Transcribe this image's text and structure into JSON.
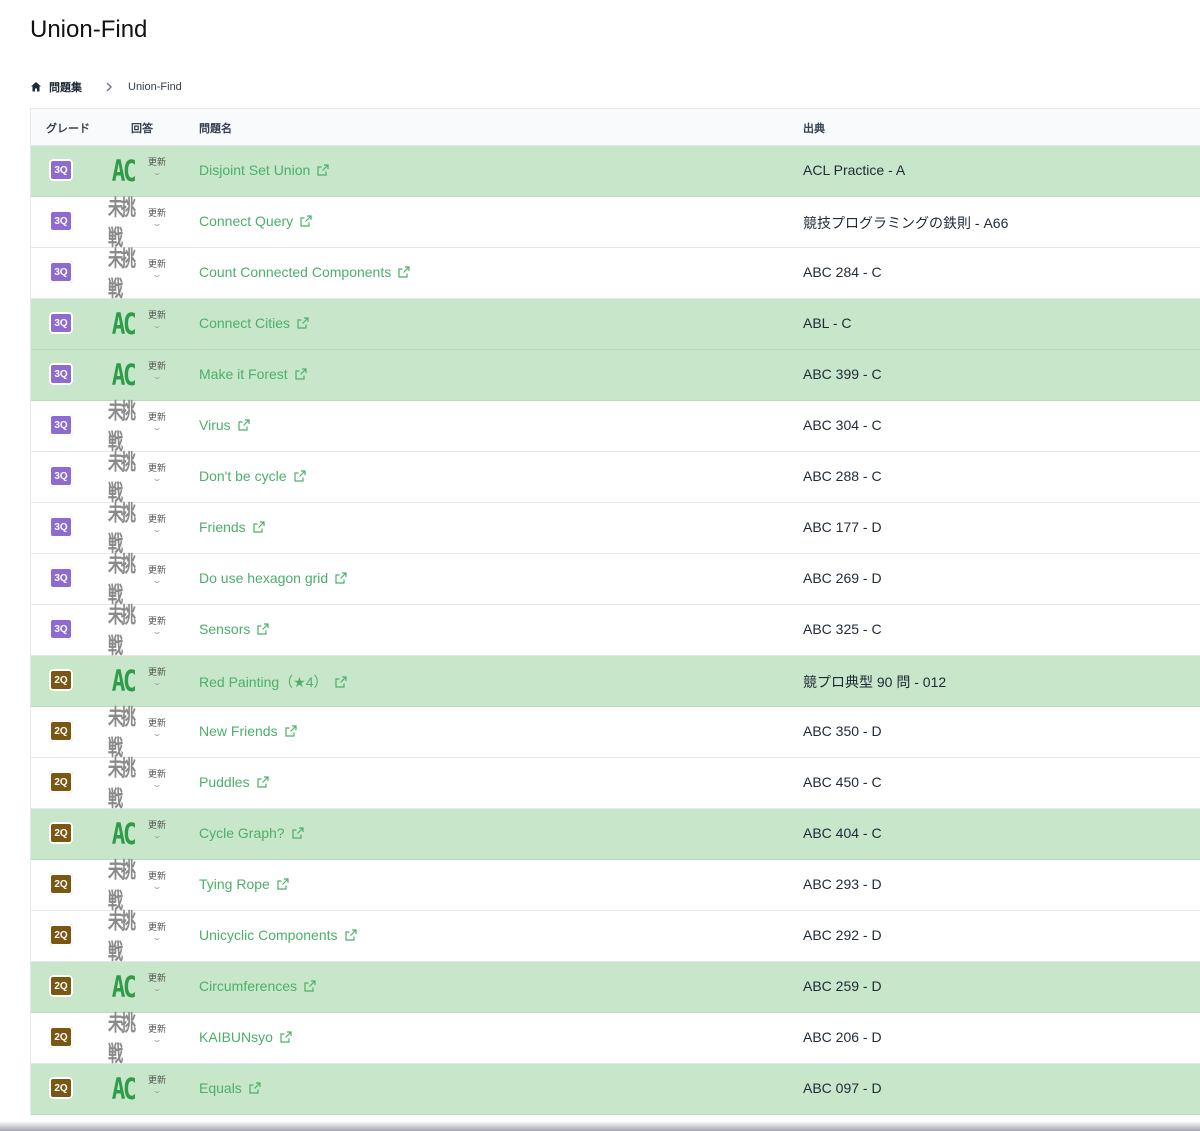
{
  "page_title": "Union-Find",
  "breadcrumb": {
    "home_label": "問題集",
    "current": "Union-Find"
  },
  "table": {
    "headers": {
      "grade": "グレード",
      "answer": "回答",
      "title": "問題名",
      "source": "出典"
    },
    "update_label": "更新",
    "rows": [
      {
        "grade": "3Q",
        "answer": "AC",
        "title": "Disjoint Set Union",
        "source": "ACL Practice - A"
      },
      {
        "grade": "3Q",
        "answer": "未挑戦",
        "title": "Connect Query",
        "source": "競技プログラミングの鉄則 - A66"
      },
      {
        "grade": "3Q",
        "answer": "未挑戦",
        "title": "Count Connected Components",
        "source": "ABC 284 - C"
      },
      {
        "grade": "3Q",
        "answer": "AC",
        "title": "Connect Cities",
        "source": "ABL - C"
      },
      {
        "grade": "3Q",
        "answer": "AC",
        "title": "Make it Forest",
        "source": "ABC 399 - C"
      },
      {
        "grade": "3Q",
        "answer": "未挑戦",
        "title": "Virus",
        "source": "ABC 304 - C"
      },
      {
        "grade": "3Q",
        "answer": "未挑戦",
        "title": "Don't be cycle",
        "source": "ABC 288 - C"
      },
      {
        "grade": "3Q",
        "answer": "未挑戦",
        "title": "Friends",
        "source": "ABC 177 - D"
      },
      {
        "grade": "3Q",
        "answer": "未挑戦",
        "title": "Do use hexagon grid",
        "source": "ABC 269 - D"
      },
      {
        "grade": "3Q",
        "answer": "未挑戦",
        "title": "Sensors",
        "source": "ABC 325 - C"
      },
      {
        "grade": "2Q",
        "answer": "AC",
        "title": "Red Painting（★4）",
        "source": "競プロ典型 90 問 - 012"
      },
      {
        "grade": "2Q",
        "answer": "未挑戦",
        "title": "New Friends",
        "source": "ABC 350 - D"
      },
      {
        "grade": "2Q",
        "answer": "未挑戦",
        "title": "Puddles",
        "source": "ABC 450 - C"
      },
      {
        "grade": "2Q",
        "answer": "AC",
        "title": "Cycle Graph?",
        "source": "ABC 404 - C"
      },
      {
        "grade": "2Q",
        "answer": "未挑戦",
        "title": "Tying Rope",
        "source": "ABC 293 - D"
      },
      {
        "grade": "2Q",
        "answer": "未挑戦",
        "title": "Unicyclic Components",
        "source": "ABC 292 - D"
      },
      {
        "grade": "2Q",
        "answer": "AC",
        "title": "Circumferences",
        "source": "ABC 259 - D"
      },
      {
        "grade": "2Q",
        "answer": "未挑戦",
        "title": "KAIBUNsyo",
        "source": "ABC 206 - D"
      },
      {
        "grade": "2Q",
        "answer": "AC",
        "title": "Equals",
        "source": "ABC 097 - D"
      }
    ]
  },
  "colors": {
    "ac_row": "#c8e6c9",
    "grade_3q": "#8e6bd1",
    "grade_2q": "#7a5712",
    "link": "#4caf6a",
    "ac_mark": "#2e9c4a"
  },
  "icons": {
    "home": "home-icon",
    "separator": "chevron-right-icon",
    "external": "external-link-icon",
    "update_toggle": "chevron-down-icon"
  }
}
